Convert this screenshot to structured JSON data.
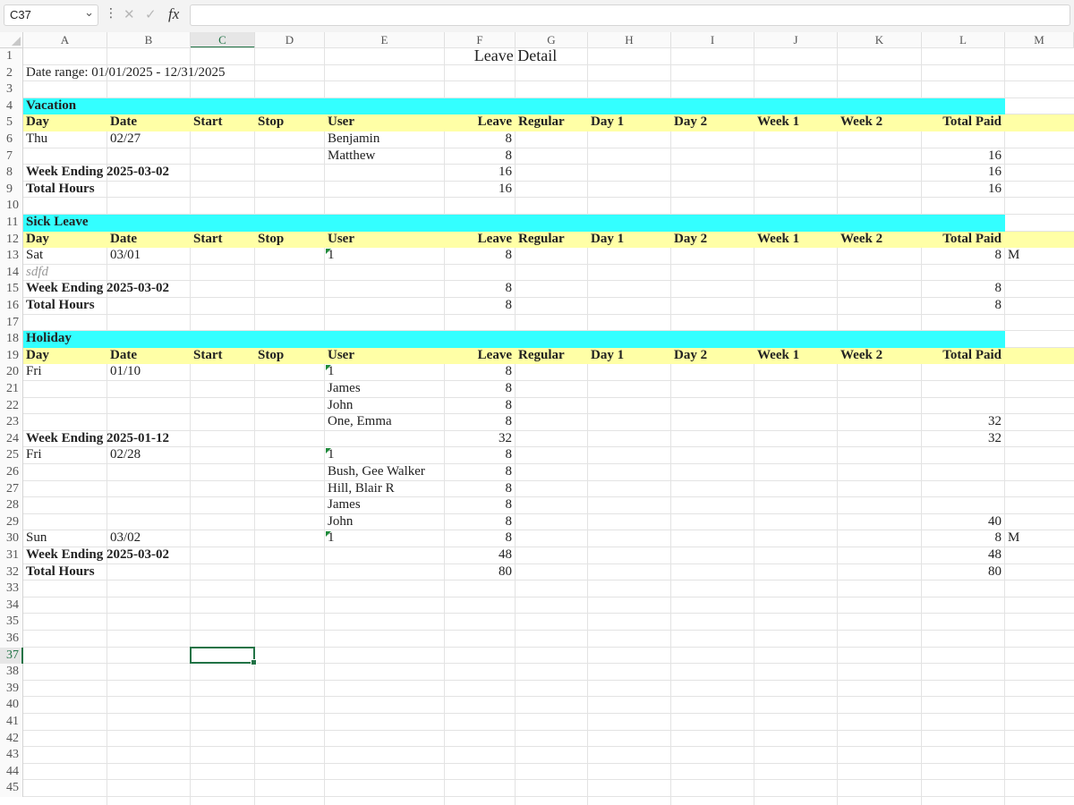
{
  "formula_bar": {
    "name_box": "C37",
    "formula_value": "",
    "icons": [
      "chevron-down-icon",
      "more-vertical-icon",
      "cancel-icon",
      "confirm-icon",
      "fx-icon"
    ],
    "fx_label": "fx"
  },
  "sheet": {
    "columns": [
      "A",
      "B",
      "C",
      "D",
      "E",
      "F",
      "G",
      "H",
      "I",
      "J",
      "K",
      "L",
      "M"
    ],
    "selected_column": "C",
    "selected_row": 37,
    "row_count": 45,
    "colors": {
      "section_band": "#33FFFF",
      "header_band": "#FFFFA6",
      "selection": "#217346",
      "comment_marker": "#1E8A3A"
    },
    "cells": {
      "title": "Leave Detail",
      "date_range": "Date range: 01/01/2025 - 12/31/2025",
      "headers": [
        "Day",
        "Date",
        "Start",
        "Stop",
        "User",
        "Leave",
        "Regular",
        "Day 1",
        "Day 2",
        "Week 1",
        "Week 2",
        "Total Paid"
      ],
      "vacation": {
        "section": "Vacation",
        "r6": {
          "day": "Thu",
          "date": "02/27",
          "user": "Benjamin",
          "leave": "8"
        },
        "r7": {
          "user": "Matthew",
          "leave": "8",
          "total": "16"
        },
        "r8": {
          "label": "Week Ending 2025-03-02",
          "leave": "16",
          "total": "16"
        },
        "r9": {
          "label": "Total Hours",
          "leave": "16",
          "total": "16"
        }
      },
      "sick": {
        "section": "Sick Leave",
        "r13": {
          "day": "Sat",
          "date": "03/01",
          "user": "1",
          "leave": "8",
          "total": "8",
          "m": "M"
        },
        "r14": {
          "note": "sdfd"
        },
        "r15": {
          "label": "Week Ending 2025-03-02",
          "leave": "8",
          "total": "8"
        },
        "r16": {
          "label": "Total Hours",
          "leave": "8",
          "total": "8"
        }
      },
      "holiday": {
        "section": "Holiday",
        "r20": {
          "day": "Fri",
          "date": "01/10",
          "user": "1",
          "leave": "8"
        },
        "r21": {
          "user": "James",
          "leave": "8"
        },
        "r22": {
          "user": "John",
          "leave": "8"
        },
        "r23": {
          "user": "One, Emma",
          "leave": "8",
          "total": "32"
        },
        "r24": {
          "label": "Week Ending 2025-01-12",
          "leave": "32",
          "total": "32"
        },
        "r25": {
          "day": "Fri",
          "date": "02/28",
          "user": "1",
          "leave": "8"
        },
        "r26": {
          "user": "Bush, Gee Walker",
          "leave": "8"
        },
        "r27": {
          "user": "Hill, Blair R",
          "leave": "8"
        },
        "r28": {
          "user": "James",
          "leave": "8"
        },
        "r29": {
          "user": "John",
          "leave": "8",
          "total": "40"
        },
        "r30": {
          "day": "Sun",
          "date": "03/02",
          "user": "1",
          "leave": "8",
          "total": "8",
          "m": "M"
        },
        "r31": {
          "label": "Week Ending 2025-03-02",
          "leave": "48",
          "total": "48"
        },
        "r32": {
          "label": "Total Hours",
          "leave": "80",
          "total": "80"
        }
      }
    }
  }
}
